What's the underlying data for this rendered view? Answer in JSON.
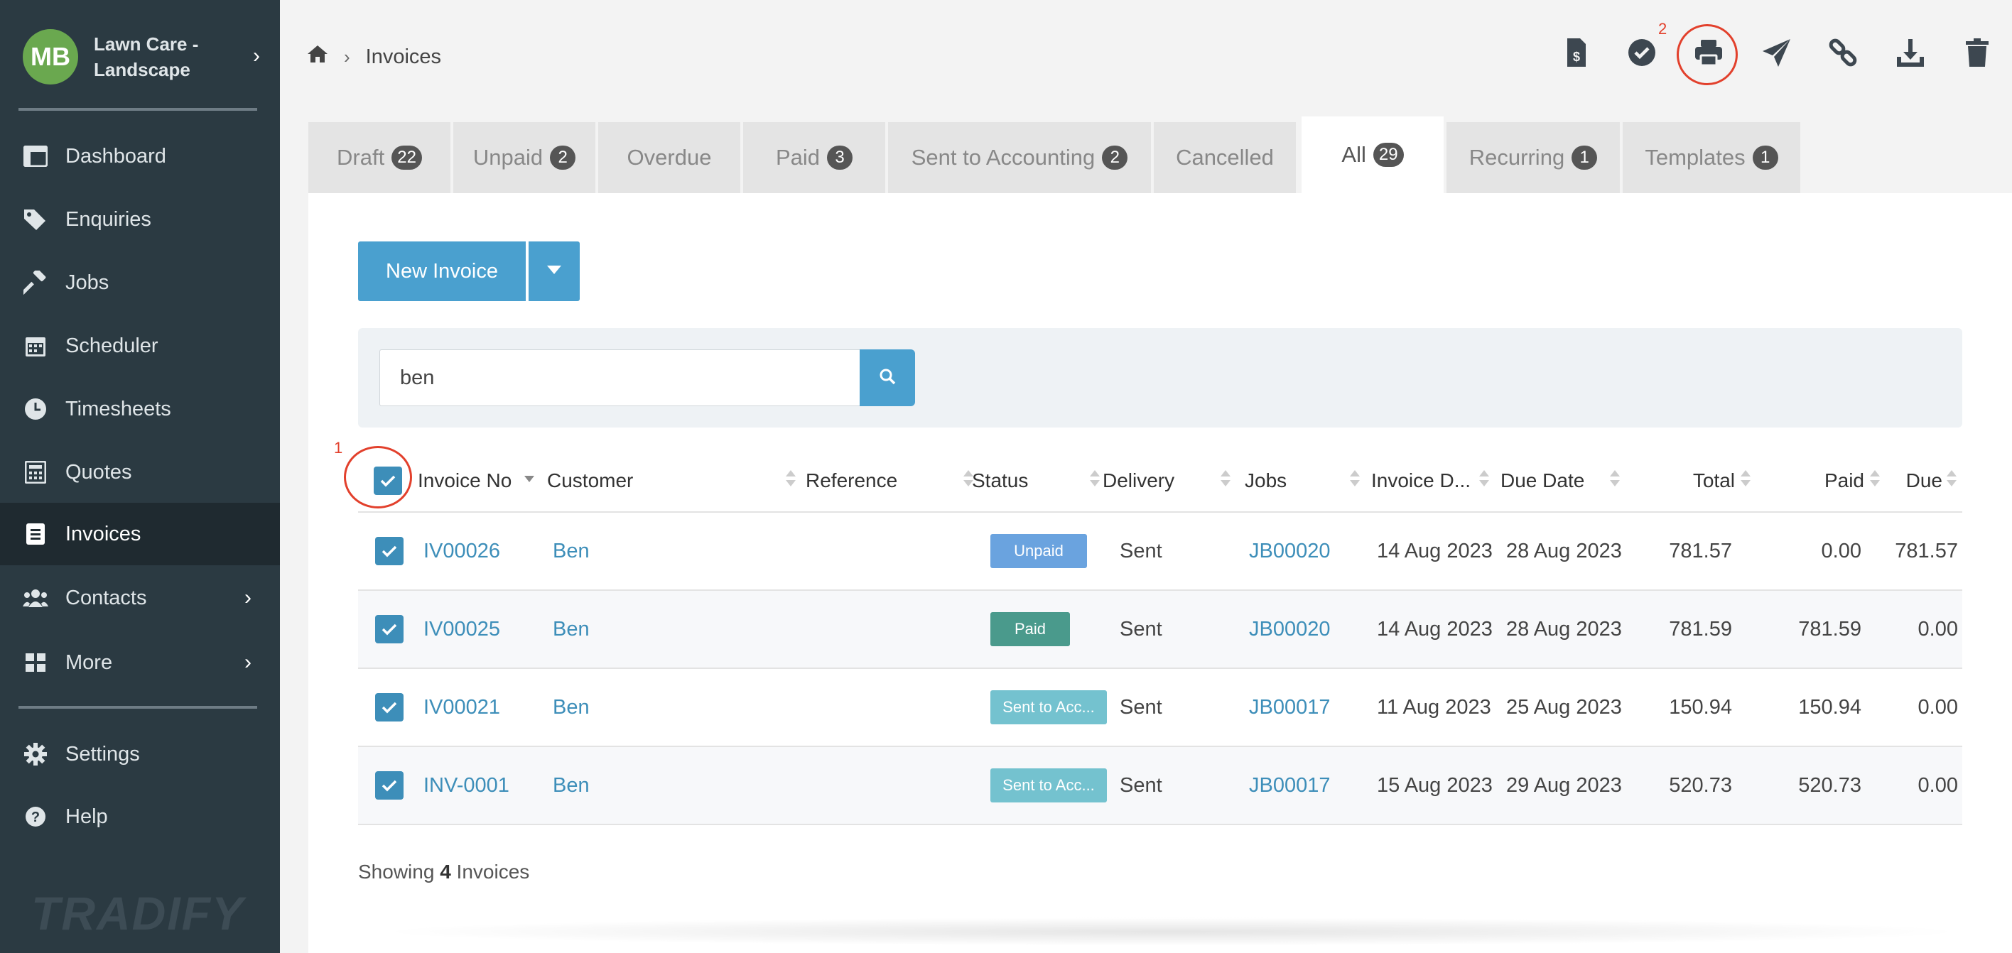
{
  "sidebar": {
    "avatar_initials": "MB",
    "company_name": "Lawn Care - Landscape",
    "items": [
      {
        "label": "Dashboard",
        "icon": "dashboard-icon"
      },
      {
        "label": "Enquiries",
        "icon": "tags-icon"
      },
      {
        "label": "Jobs",
        "icon": "hammer-icon"
      },
      {
        "label": "Scheduler",
        "icon": "calendar-icon"
      },
      {
        "label": "Timesheets",
        "icon": "clock-icon"
      },
      {
        "label": "Quotes",
        "icon": "calculator-icon"
      },
      {
        "label": "Invoices",
        "icon": "invoice-icon",
        "active": true
      },
      {
        "label": "Contacts",
        "icon": "users-icon"
      },
      {
        "label": "More",
        "icon": "grid-icon"
      },
      {
        "label": "Settings",
        "icon": "gear-icon"
      },
      {
        "label": "Help",
        "icon": "help-icon"
      }
    ],
    "logo_text": "TRADIFY",
    "colors": {
      "background": "#2b3a42",
      "active": "#1f2a30",
      "avatar": "#6aa84f"
    }
  },
  "breadcrumb": {
    "current": "Invoices"
  },
  "toolbar": {
    "icons": [
      "invoice-dollar-icon",
      "check-circle-icon",
      "print-icon",
      "send-icon",
      "link-icon",
      "download-icon",
      "trash-icon"
    ],
    "annotation_print": "2",
    "annotation_select_all": "1",
    "annotation_color": "#e2402c"
  },
  "tabs": [
    {
      "label": "Draft",
      "count": "22"
    },
    {
      "label": "Unpaid",
      "count": "2"
    },
    {
      "label": "Overdue",
      "count": ""
    },
    {
      "label": "Paid",
      "count": "3"
    },
    {
      "label": "Sent to Accounting",
      "count": "2"
    },
    {
      "label": "Cancelled",
      "count": ""
    },
    {
      "label": "All",
      "count": "29",
      "active": true
    },
    {
      "label": "Recurring",
      "count": "1"
    },
    {
      "label": "Templates",
      "count": "1"
    }
  ],
  "actions": {
    "new_invoice_label": "New Invoice",
    "accent": "#4aa0cf"
  },
  "search": {
    "value": "ben"
  },
  "table": {
    "columns": [
      "Invoice No",
      "Customer",
      "Reference",
      "Status",
      "Delivery",
      "Jobs",
      "Invoice D...",
      "Due Date",
      "Total",
      "Paid",
      "Due"
    ],
    "rows": [
      {
        "invoice_no": "IV00026",
        "customer": "Ben",
        "reference": "",
        "status": "Unpaid",
        "delivery": "Sent",
        "jobs": "JB00020",
        "invoice_date": "14 Aug 2023",
        "due_date": "28 Aug 2023",
        "total": "781.57",
        "paid": "0.00",
        "due": "781.57"
      },
      {
        "invoice_no": "IV00025",
        "customer": "Ben",
        "reference": "",
        "status": "Paid",
        "delivery": "Sent",
        "jobs": "JB00020",
        "invoice_date": "14 Aug 2023",
        "due_date": "28 Aug 2023",
        "total": "781.59",
        "paid": "781.59",
        "due": "0.00"
      },
      {
        "invoice_no": "IV00021",
        "customer": "Ben",
        "reference": "",
        "status": "Sent to Acc...",
        "delivery": "Sent",
        "jobs": "JB00017",
        "invoice_date": "11 Aug 2023",
        "due_date": "25 Aug 2023",
        "total": "150.94",
        "paid": "150.94",
        "due": "0.00"
      },
      {
        "invoice_no": "INV-0001",
        "customer": "Ben",
        "reference": "",
        "status": "Sent to Acc...",
        "delivery": "Sent",
        "jobs": "JB00017",
        "invoice_date": "15 Aug 2023",
        "due_date": "29 Aug 2023",
        "total": "520.73",
        "paid": "520.73",
        "due": "0.00"
      }
    ],
    "status_colors": {
      "Unpaid": "#6aa3df",
      "Paid": "#4a9a8c",
      "Sent to Acc...": "#74c2cf"
    }
  },
  "footer": {
    "showing_prefix": "Showing",
    "showing_count": "4",
    "showing_suffix": "Invoices"
  }
}
